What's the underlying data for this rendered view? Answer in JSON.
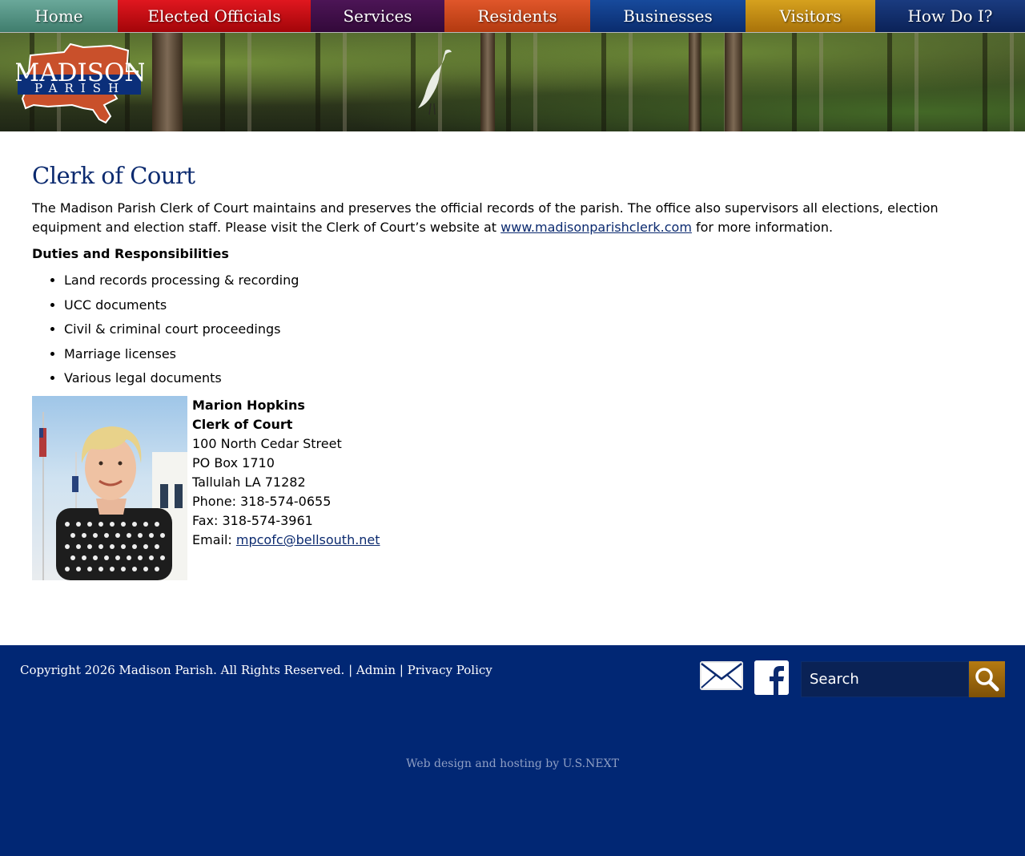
{
  "nav": {
    "items": [
      {
        "label": "Home",
        "color": "#4f8f80"
      },
      {
        "label": "Elected Officials",
        "color": "#c20c12"
      },
      {
        "label": "Services",
        "color": "#3e0f47"
      },
      {
        "label": "Residents",
        "color": "#cc4a1c"
      },
      {
        "label": "Businesses",
        "color": "#0f3a85"
      },
      {
        "label": "Visitors",
        "color": "#c18c14"
      },
      {
        "label": "How Do I?",
        "color": "#12306b"
      }
    ]
  },
  "logo": {
    "line1": "MADISON",
    "line2": "PARISH"
  },
  "page": {
    "title": "Clerk of Court",
    "intro_before": "The Madison Parish Clerk of Court maintains and preserves the official records of the parish. The office also supervisors all elections, election equipment and election staff. Please visit the Clerk of Court’s website at ",
    "intro_link": "www.madisonparishclerk.com",
    "intro_after": " for more information.",
    "duties_heading": "Duties and Responsibilities",
    "duties": [
      "Land records processing & recording",
      "UCC documents",
      "Civil & criminal court proceedings",
      "Marriage licenses",
      "Various legal documents"
    ]
  },
  "contact": {
    "name": "Marion Hopkins",
    "role": "Clerk of Court",
    "street": "100 North Cedar Street",
    "po_box": "PO Box 1710",
    "city": "Tallulah LA 71282",
    "phone": "Phone: 318-574-0655",
    "fax": "Fax: 318-574-3961",
    "email_label": "Email: ",
    "email": "mpcofc@bellsouth.net"
  },
  "footer": {
    "copyright": "Copyright 2026 Madison Parish. All Rights Reserved.",
    "sep1": " | ",
    "admin": "Admin",
    "sep2": " | ",
    "privacy": "Privacy Policy",
    "search_placeholder": "Search",
    "credit": "Web design and hosting by U.S.NEXT",
    "background": "#012774"
  },
  "icons": {
    "mail": "mail-icon",
    "facebook": "facebook-icon",
    "search": "search-icon"
  }
}
